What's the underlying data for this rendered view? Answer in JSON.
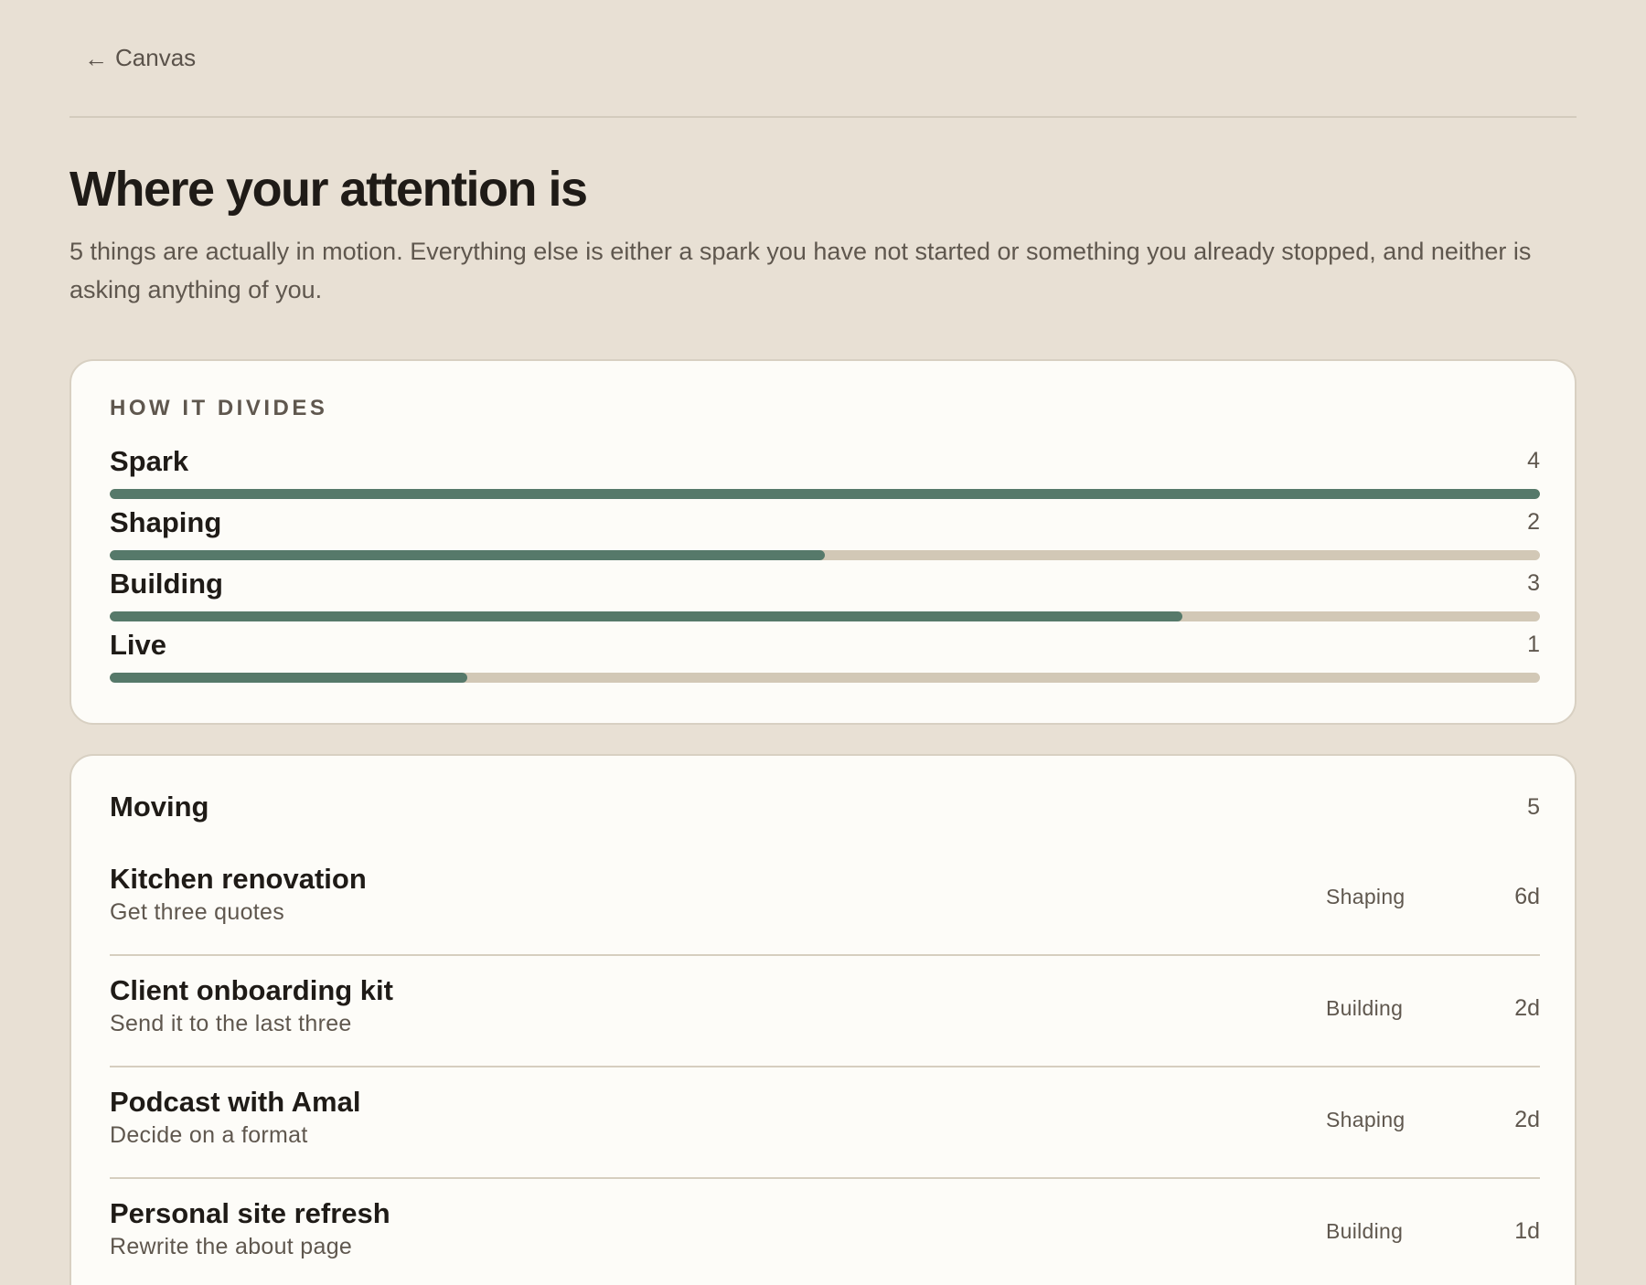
{
  "nav": {
    "back_label": "Canvas"
  },
  "header": {
    "title": "Where your attention is",
    "subtitle": "5 things are actually in motion. Everything else is either a spark you have not started or something you already stopped, and neither is asking anything of you."
  },
  "divides": {
    "heading": "HOW IT DIVIDES",
    "max": 4,
    "rows": [
      {
        "label": "Spark",
        "count": "4",
        "value": 4
      },
      {
        "label": "Shaping",
        "count": "2",
        "value": 2
      },
      {
        "label": "Building",
        "count": "3",
        "value": 3
      },
      {
        "label": "Live",
        "count": "1",
        "value": 1
      }
    ]
  },
  "moving": {
    "title": "Moving",
    "count": "5",
    "items": [
      {
        "title": "Kitchen renovation",
        "next": "Get three quotes",
        "stage": "Shaping",
        "age": "6d"
      },
      {
        "title": "Client onboarding kit",
        "next": "Send it to the last three",
        "stage": "Building",
        "age": "2d"
      },
      {
        "title": "Podcast with Amal",
        "next": "Decide on a format",
        "stage": "Shaping",
        "age": "2d"
      },
      {
        "title": "Personal site refresh",
        "next": "Rewrite the about page",
        "stage": "Building",
        "age": "1d"
      }
    ]
  },
  "colors": {
    "background": "#e8e0d4",
    "card": "#fdfcf8",
    "bar_fill": "#56796a",
    "bar_track": "#d2c8b6"
  }
}
